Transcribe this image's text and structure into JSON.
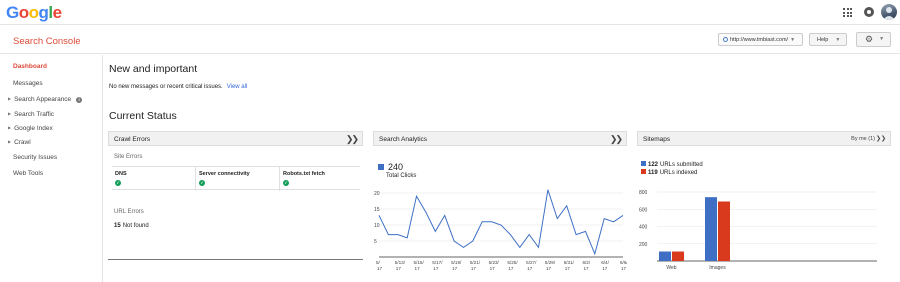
{
  "google": {
    "logo_letters": [
      {
        "ch": "G",
        "color": "#4285f4"
      },
      {
        "ch": "o",
        "color": "#ea4335"
      },
      {
        "ch": "o",
        "color": "#fbbc05"
      },
      {
        "ch": "g",
        "color": "#4285f4"
      },
      {
        "ch": "l",
        "color": "#34a853"
      },
      {
        "ch": "e",
        "color": "#ea4335"
      }
    ],
    "icons": [
      "apps-icon",
      "notifications-icon",
      "avatar"
    ]
  },
  "header": {
    "title": "Search Console",
    "site_url": "http://www.tmbiast.com/",
    "help_label": "Help",
    "accent_color": "#dd4b39"
  },
  "sidebar": {
    "items": [
      {
        "label": "Dashboard",
        "active": true,
        "expandable": false
      },
      {
        "label": "Messages",
        "active": false,
        "expandable": false
      },
      {
        "label": "Search Appearance",
        "active": false,
        "expandable": true,
        "info": true
      },
      {
        "label": "Search Traffic",
        "active": false,
        "expandable": true
      },
      {
        "label": "Google Index",
        "active": false,
        "expandable": true
      },
      {
        "label": "Crawl",
        "active": false,
        "expandable": true
      },
      {
        "label": "Security Issues",
        "active": false,
        "expandable": false
      },
      {
        "label": "Web Tools",
        "active": false,
        "expandable": false
      }
    ]
  },
  "main": {
    "new_important_title": "New and important",
    "no_messages_text": "No new messages or recent critical issues.",
    "view_all_label": "View all",
    "current_status_title": "Current Status",
    "crawl_errors": {
      "title": "Crawl Errors",
      "site_errors_label": "Site Errors",
      "columns": [
        {
          "label": "DNS",
          "status": "ok"
        },
        {
          "label": "Server connectivity",
          "status": "ok"
        },
        {
          "label": "Robots.txt fetch",
          "status": "ok"
        }
      ],
      "url_errors_label": "URL Errors",
      "not_found_count": "15",
      "not_found_label": "Not found"
    },
    "search_analytics": {
      "title": "Search Analytics",
      "total_clicks_value": "240",
      "total_clicks_label": "Total Clicks"
    },
    "sitemaps": {
      "title": "Sitemaps",
      "by_me_label": "By me (1)",
      "submitted_count": "122",
      "submitted_label": "URLs submitted",
      "indexed_count": "119",
      "indexed_label": "URLs indexed",
      "submitted_color": "#3e6fc4",
      "indexed_color": "#d93a1d"
    }
  },
  "chart_data": [
    {
      "type": "line",
      "title": "Search Analytics",
      "series": [
        {
          "name": "Total Clicks",
          "values": [
            13,
            7,
            7,
            6,
            19,
            14,
            8,
            13,
            5,
            3,
            5,
            11,
            11,
            10,
            7,
            3,
            7,
            3,
            21,
            12,
            16,
            7,
            8,
            1,
            12,
            11,
            13
          ]
        }
      ],
      "ylim": [
        0,
        20
      ],
      "yticks": [
        0,
        5,
        10,
        15,
        20
      ],
      "xtick_labels": [
        {
          "top": "5/",
          "bottom": "17"
        },
        {
          "top": "5/13/",
          "bottom": "17"
        },
        {
          "top": "5/15/",
          "bottom": "17"
        },
        {
          "top": "5/17/",
          "bottom": "17"
        },
        {
          "top": "5/19/",
          "bottom": "17"
        },
        {
          "top": "5/21/",
          "bottom": "17"
        },
        {
          "top": "5/23/",
          "bottom": "17"
        },
        {
          "top": "5/25/",
          "bottom": "17"
        },
        {
          "top": "5/27/",
          "bottom": "17"
        },
        {
          "top": "5/29/",
          "bottom": "17"
        },
        {
          "top": "5/31/",
          "bottom": "17"
        },
        {
          "top": "6/2/",
          "bottom": "17"
        },
        {
          "top": "6/4/",
          "bottom": "17"
        },
        {
          "top": "6/6/",
          "bottom": "17"
        }
      ],
      "color": "#3e6fc4",
      "grid": true
    },
    {
      "type": "bar",
      "title": "Sitemaps",
      "categories": [
        "Web",
        "Images"
      ],
      "series": [
        {
          "name": "URLs submitted",
          "values": [
            110,
            740
          ],
          "color": "#3e6fc4"
        },
        {
          "name": "URLs indexed",
          "values": [
            110,
            690
          ],
          "color": "#d93a1d"
        }
      ],
      "ylim": [
        0,
        800
      ],
      "yticks": [
        0,
        200,
        400,
        600,
        800
      ],
      "grid": true
    }
  ]
}
